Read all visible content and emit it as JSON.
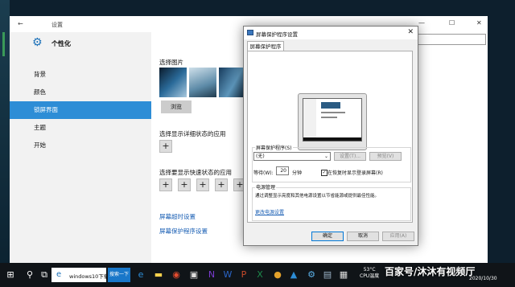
{
  "settings": {
    "title": "设置",
    "header": "个性化",
    "nav": [
      {
        "label": "背景"
      },
      {
        "label": "颜色"
      },
      {
        "label": "锁屏界面"
      },
      {
        "label": "主题"
      },
      {
        "label": "开始"
      }
    ],
    "main": {
      "choose_picture": "选择图片",
      "browse": "浏览",
      "detail_app": "选择显示详细状态的应用",
      "quick_apps": "选择要显示快速状态的应用",
      "link_timeout": "屏幕超时设置",
      "link_saver": "屏幕保护程序设置"
    }
  },
  "dialog": {
    "title": "屏幕保护程序设置",
    "tab": "屏幕保护程序",
    "group_saver": "屏幕保护程序(S)",
    "saver_value": "(无)",
    "settings_btn": "设置(T)...",
    "preview_btn": "预览(V)",
    "wait_label": "等待(W):",
    "wait_value": "20",
    "minutes": "分钟",
    "resume_check": "在恢复时显示登录屏幕(R)",
    "group_power": "电源管理",
    "power_desc": "通过调整显示亮度和其他电源设置以节省能源或提供最佳性能。",
    "power_link": "更改电源设置",
    "ok": "确定",
    "cancel": "取消",
    "apply": "应用(A)"
  },
  "taskbar": {
    "search_text": "windows10下载",
    "search_btn": "搜索一下",
    "temp": "53°C",
    "temp_label": "CPU温度",
    "date": "2020/10/30"
  },
  "watermark": "百家号/沐沐有视频厅"
}
